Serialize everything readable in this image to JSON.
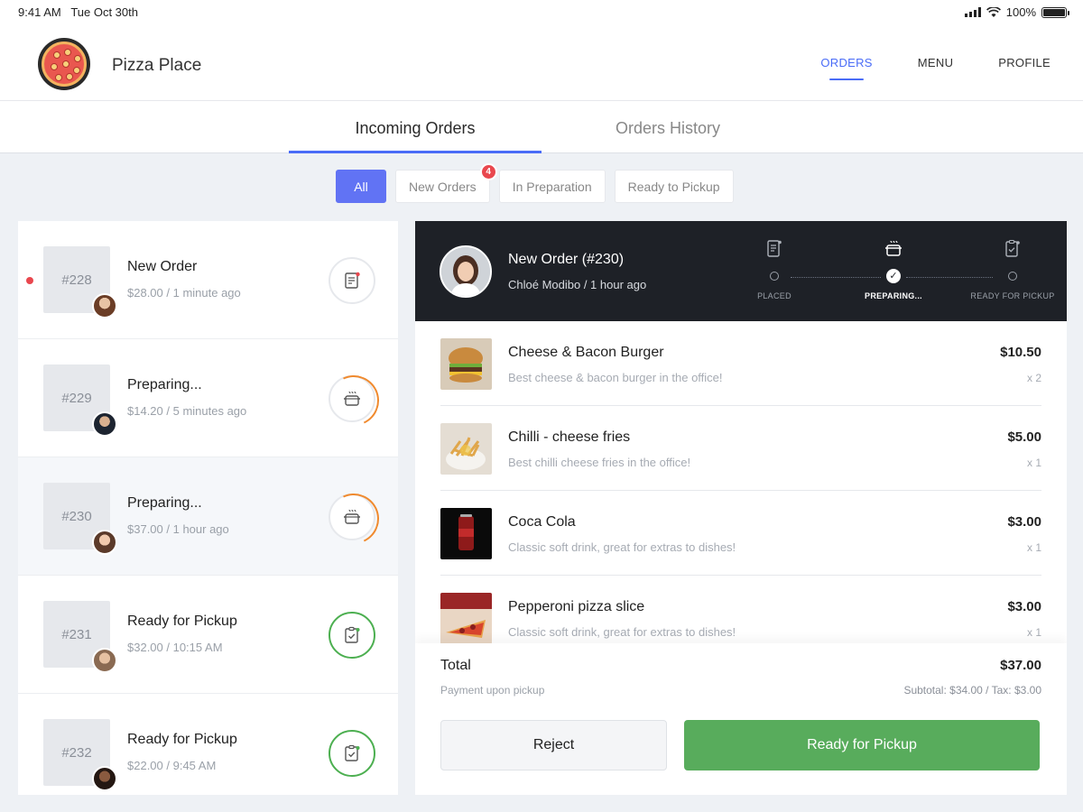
{
  "status_bar": {
    "time": "9:41 AM",
    "date": "Tue Oct 30th",
    "battery": "100%"
  },
  "header": {
    "brand": "Pizza Place",
    "nav": [
      {
        "label": "ORDERS",
        "active": true
      },
      {
        "label": "MENU",
        "active": false
      },
      {
        "label": "PROFILE",
        "active": false
      }
    ]
  },
  "tabs": [
    {
      "label": "Incoming Orders",
      "active": true
    },
    {
      "label": "Orders History",
      "active": false
    }
  ],
  "filters": [
    {
      "label": "All",
      "active": true
    },
    {
      "label": "New Orders",
      "badge": "4"
    },
    {
      "label": "In Preparation"
    },
    {
      "label": "Ready to Pickup"
    }
  ],
  "orders": [
    {
      "id": "#228",
      "title": "New Order",
      "meta": "$28.00 / 1 minute ago",
      "status": "new"
    },
    {
      "id": "#229",
      "title": "Preparing...",
      "meta": "$14.20 / 5 minutes ago",
      "status": "preparing"
    },
    {
      "id": "#230",
      "title": "Preparing...",
      "meta": "$37.00 / 1 hour ago",
      "status": "preparing"
    },
    {
      "id": "#231",
      "title": "Ready for Pickup",
      "meta": "$32.00 / 10:15 AM",
      "status": "ready"
    },
    {
      "id": "#232",
      "title": "Ready for Pickup",
      "meta": "$22.00 / 9:45 AM",
      "status": "ready"
    }
  ],
  "detail": {
    "title": "New Order (#230)",
    "subtitle": "Chloé Modibo / 1 hour ago",
    "steps": [
      {
        "label": "PLACED"
      },
      {
        "label": "PREPARING..."
      },
      {
        "label": "READY FOR PICKUP"
      }
    ],
    "items": [
      {
        "name": "Cheese & Bacon Burger",
        "desc": "Best cheese & bacon burger in the office!",
        "price": "$10.50",
        "qty": "x 2"
      },
      {
        "name": "Chilli - cheese fries",
        "desc": "Best chilli cheese fries in the office!",
        "price": "$5.00",
        "qty": "x 1"
      },
      {
        "name": "Coca Cola",
        "desc": "Classic soft drink, great for extras to dishes!",
        "price": "$3.00",
        "qty": "x 1"
      },
      {
        "name": "Pepperoni pizza slice",
        "desc": "Classic soft drink, great for extras to dishes!",
        "price": "$3.00",
        "qty": "x 1"
      }
    ],
    "total_label": "Total",
    "total": "$37.00",
    "payment": "Payment upon pickup",
    "subtotal": "Subtotal: $34.00 / Tax: $3.00",
    "reject_label": "Reject",
    "ready_label": "Ready for Pickup"
  },
  "colors": {
    "accent": "#4a6cf7",
    "chip_active": "#6173f4",
    "ready_green": "#58ac5c",
    "badge_red": "#e9474e",
    "dark_header": "#1e2127",
    "progress_orange": "#f08a2e"
  }
}
